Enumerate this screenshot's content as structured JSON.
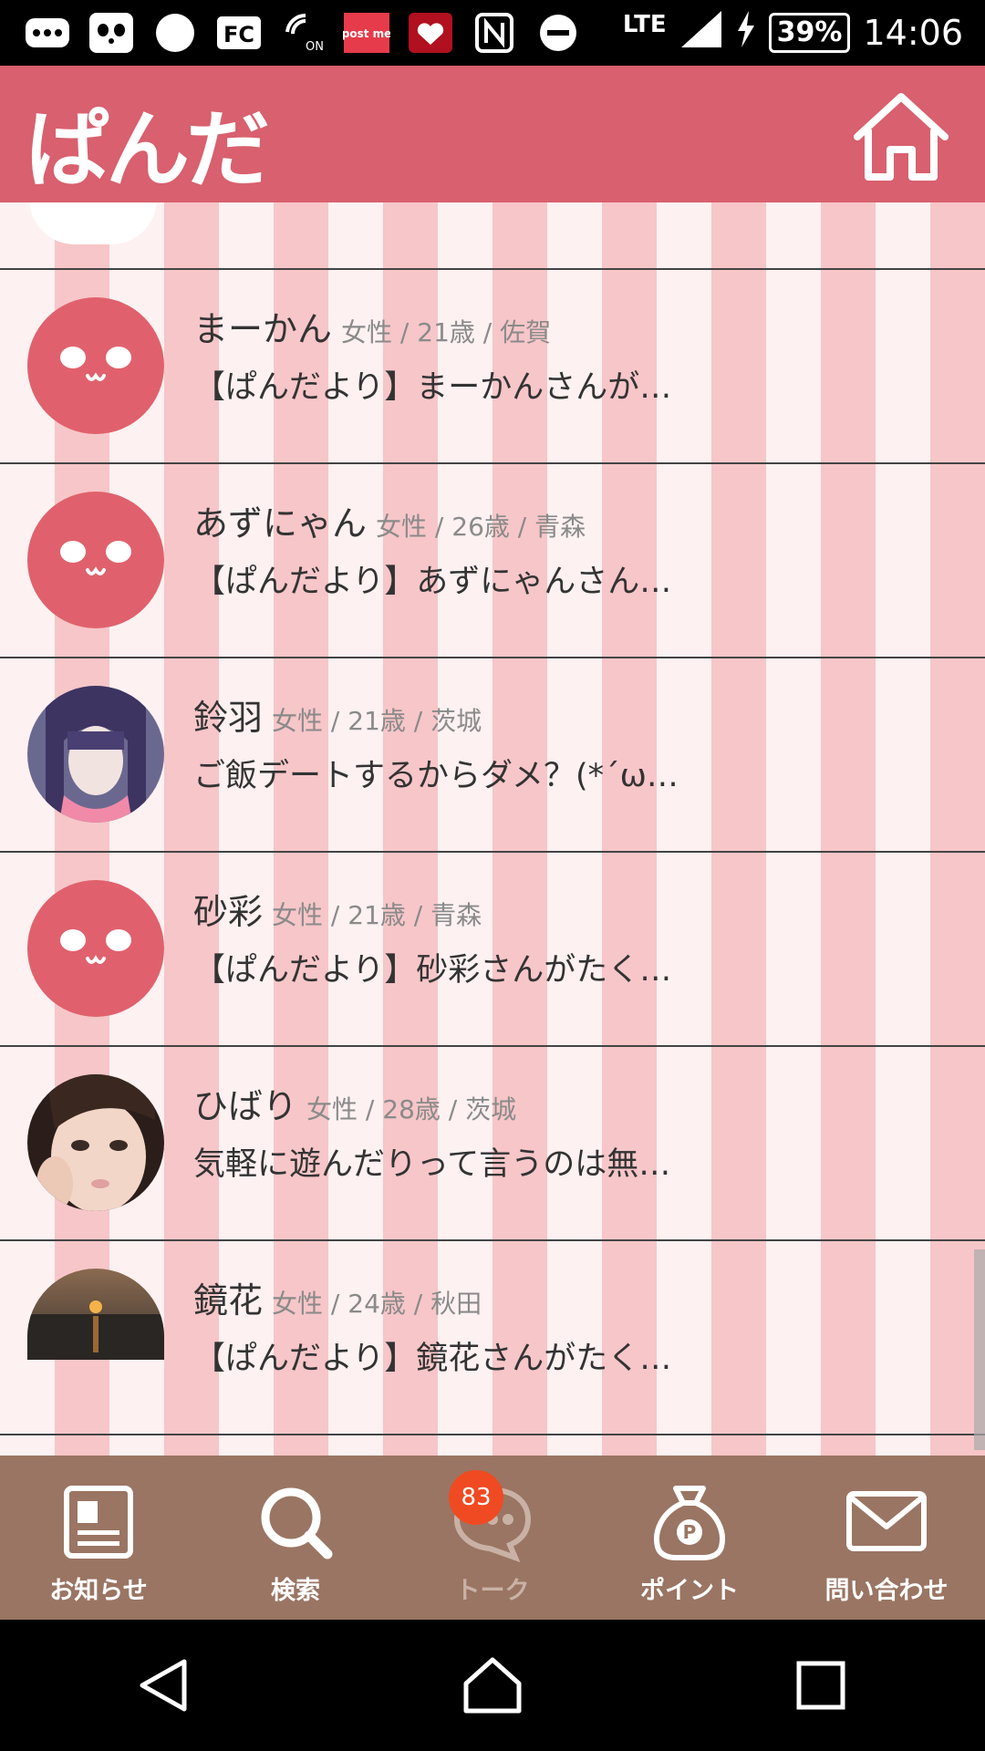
{
  "status_bar": {
    "lte": "LTE",
    "battery": "39%",
    "time": "14:06",
    "postme": "post me"
  },
  "header": {
    "logo": "ぱんだ",
    "home_icon": "home-icon"
  },
  "conversations": [
    {
      "name": "まーかん",
      "meta": "女性 / 21歳 / 佐賀",
      "message": "【ぱんだより】まーかんさんが…",
      "avatar": "panda-default"
    },
    {
      "name": "あずにゃん",
      "meta": "女性 / 26歳 / 青森",
      "message": "【ぱんだより】あずにゃんさん…",
      "avatar": "panda-default"
    },
    {
      "name": "鈴羽",
      "meta": "女性 / 21歳 / 茨城",
      "message": "ご飯デートするからダメ？(*´ω…",
      "avatar": "photo-purple-hair"
    },
    {
      "name": "砂彩",
      "meta": "女性 / 21歳 / 青森",
      "message": "【ぱんだより】砂彩さんがたく…",
      "avatar": "panda-default"
    },
    {
      "name": "ひばり",
      "meta": "女性 / 28歳 / 茨城",
      "message": "気軽に遊んだりって言うのは無…",
      "avatar": "photo-face"
    },
    {
      "name": "鏡花",
      "meta": "女性 / 24歳 / 秋田",
      "message": "【ぱんだより】鏡花さんがたく…",
      "avatar": "photo-sunset"
    }
  ],
  "bottom_nav": {
    "items": [
      {
        "label": "お知らせ",
        "icon": "news-icon"
      },
      {
        "label": "検索",
        "icon": "search-icon"
      },
      {
        "label": "トーク",
        "icon": "chat-bubble-icon",
        "badge": "83",
        "active": true
      },
      {
        "label": "ポイント",
        "icon": "points-bag-icon"
      },
      {
        "label": "問い合わせ",
        "icon": "mail-icon"
      }
    ]
  },
  "colors": {
    "header": "#d9606e",
    "stripe_light": "#fdf1f1",
    "stripe_dark": "#f7c6c8",
    "nav_bg": "#9a7563",
    "badge": "#f04a22"
  }
}
